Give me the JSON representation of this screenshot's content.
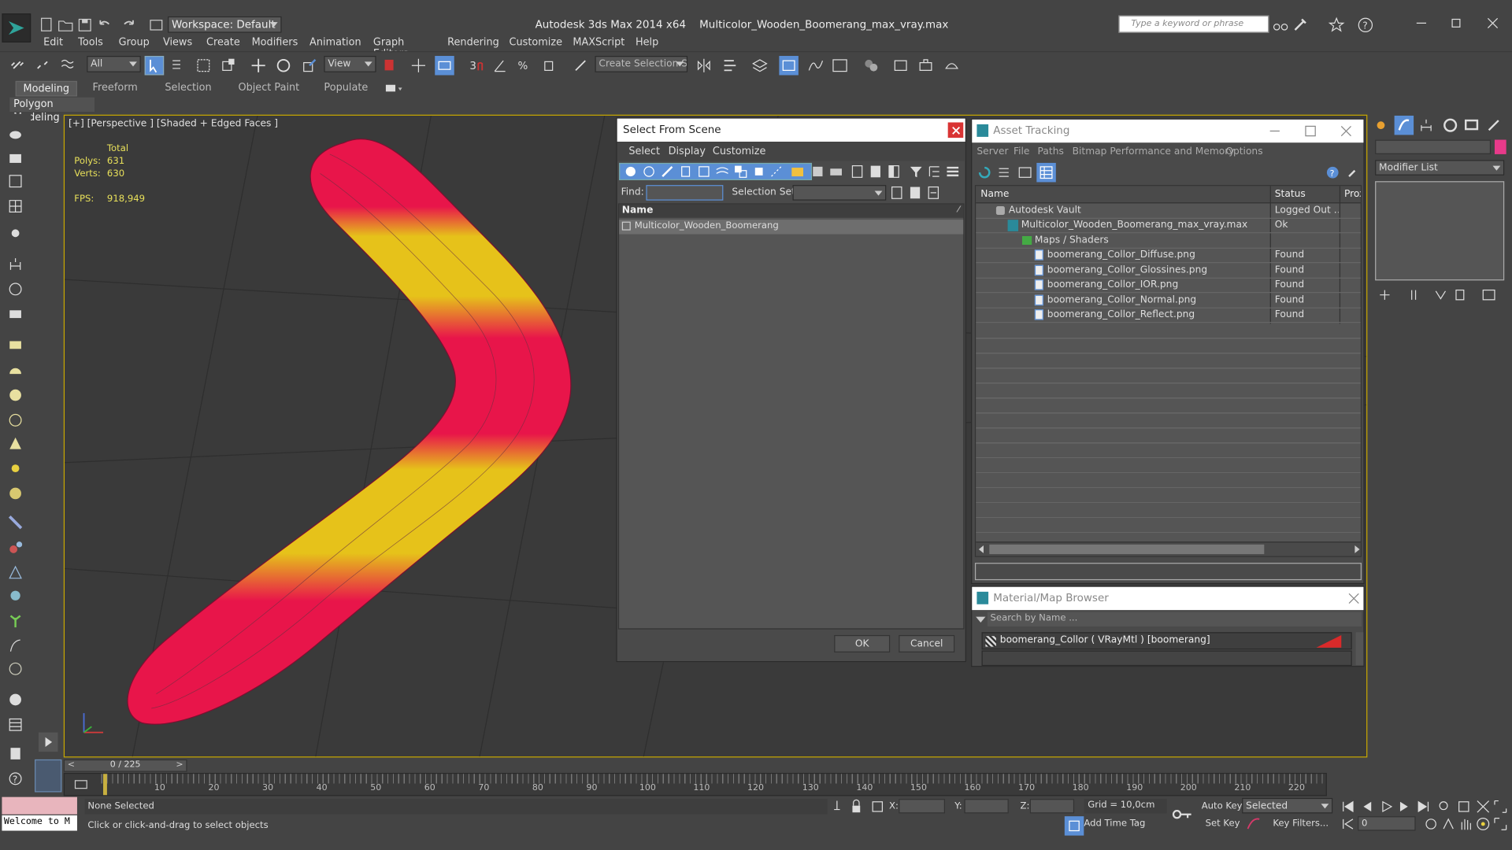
{
  "app": {
    "title": "Autodesk 3ds Max  2014 x64",
    "filename": "Multicolor_Wooden_Boomerang_max_vray.max",
    "workspace": "Workspace: Default",
    "search_placeholder": "Type a keyword or phrase"
  },
  "menu": [
    "Edit",
    "Tools",
    "Group",
    "Views",
    "Create",
    "Modifiers",
    "Animation",
    "Graph Editors",
    "Rendering",
    "Customize",
    "MAXScript",
    "Help"
  ],
  "toolbar": {
    "filter_value": "All",
    "view_value": "View",
    "selection_set_placeholder": "Create Selection Se"
  },
  "ribbon": {
    "tabs": [
      "Modeling",
      "Freeform",
      "Selection",
      "Object Paint",
      "Populate"
    ],
    "subtab": "Polygon Modeling"
  },
  "viewport": {
    "label": "[+] [Perspective ] [Shaded + Edged Faces ]",
    "stats_header": "Total",
    "polys_label": "Polys:",
    "polys_value": "631",
    "verts_label": "Verts:",
    "verts_value": "630",
    "fps_label": "FPS:",
    "fps_value": "918,949"
  },
  "select_from_scene": {
    "title": "Select From Scene",
    "menu": [
      "Select",
      "Display",
      "Customize"
    ],
    "find_label": "Find:",
    "selection_set_label": "Selection Set:",
    "column_name": "Name",
    "items": [
      "Multicolor_Wooden_Boomerang"
    ],
    "ok": "OK",
    "cancel": "Cancel"
  },
  "asset_tracking": {
    "title": "Asset Tracking",
    "menu": [
      "Server",
      "File",
      "Paths",
      "Bitmap Performance and Memory",
      "Options"
    ],
    "columns": [
      "Name",
      "Status",
      "Prox"
    ],
    "rows": [
      {
        "name": "Autodesk Vault",
        "status": "Logged Out ..."
      },
      {
        "name": "Multicolor_Wooden_Boomerang_max_vray.max",
        "status": "Ok"
      },
      {
        "name": "Maps / Shaders",
        "status": ""
      },
      {
        "name": "boomerang_Collor_Diffuse.png",
        "status": "Found"
      },
      {
        "name": "boomerang_Collor_Glossines.png",
        "status": "Found"
      },
      {
        "name": "boomerang_Collor_IOR.png",
        "status": "Found"
      },
      {
        "name": "boomerang_Collor_Normal.png",
        "status": "Found"
      },
      {
        "name": "boomerang_Collor_Reflect.png",
        "status": "Found"
      }
    ]
  },
  "material_browser": {
    "title": "Material/Map Browser",
    "search_placeholder": "Search by Name ...",
    "item": "boomerang_Collor ( VRayMtl ) [boomerang]"
  },
  "command_panel": {
    "modifier_list": "Modifier List"
  },
  "timeline": {
    "frame_counter": "0 / 225",
    "ticks": [
      "10",
      "20",
      "30",
      "40",
      "50",
      "60",
      "70",
      "80",
      "90",
      "100",
      "110",
      "120",
      "130",
      "140",
      "150",
      "160",
      "170",
      "180",
      "190",
      "200",
      "210",
      "220"
    ]
  },
  "status": {
    "maxscript": "Welcome to M",
    "selection": "None Selected",
    "prompt": "Click or click-and-drag to select objects",
    "x_label": "X:",
    "y_label": "Y:",
    "z_label": "Z:",
    "grid": "Grid = 10,0cm",
    "add_time_tag": "Add Time Tag",
    "auto_key": "Auto Key",
    "set_key": "Set Key",
    "selected": "Selected",
    "key_filters": "Key Filters...",
    "frame": "0"
  },
  "colors": {
    "bg": "#444444",
    "viewport": "#3a3a3a",
    "accent": "#5b8fd6",
    "stats": "#e8e05a",
    "boomerang_red": "#e8154a",
    "boomerang_yellow": "#e6c21a"
  }
}
